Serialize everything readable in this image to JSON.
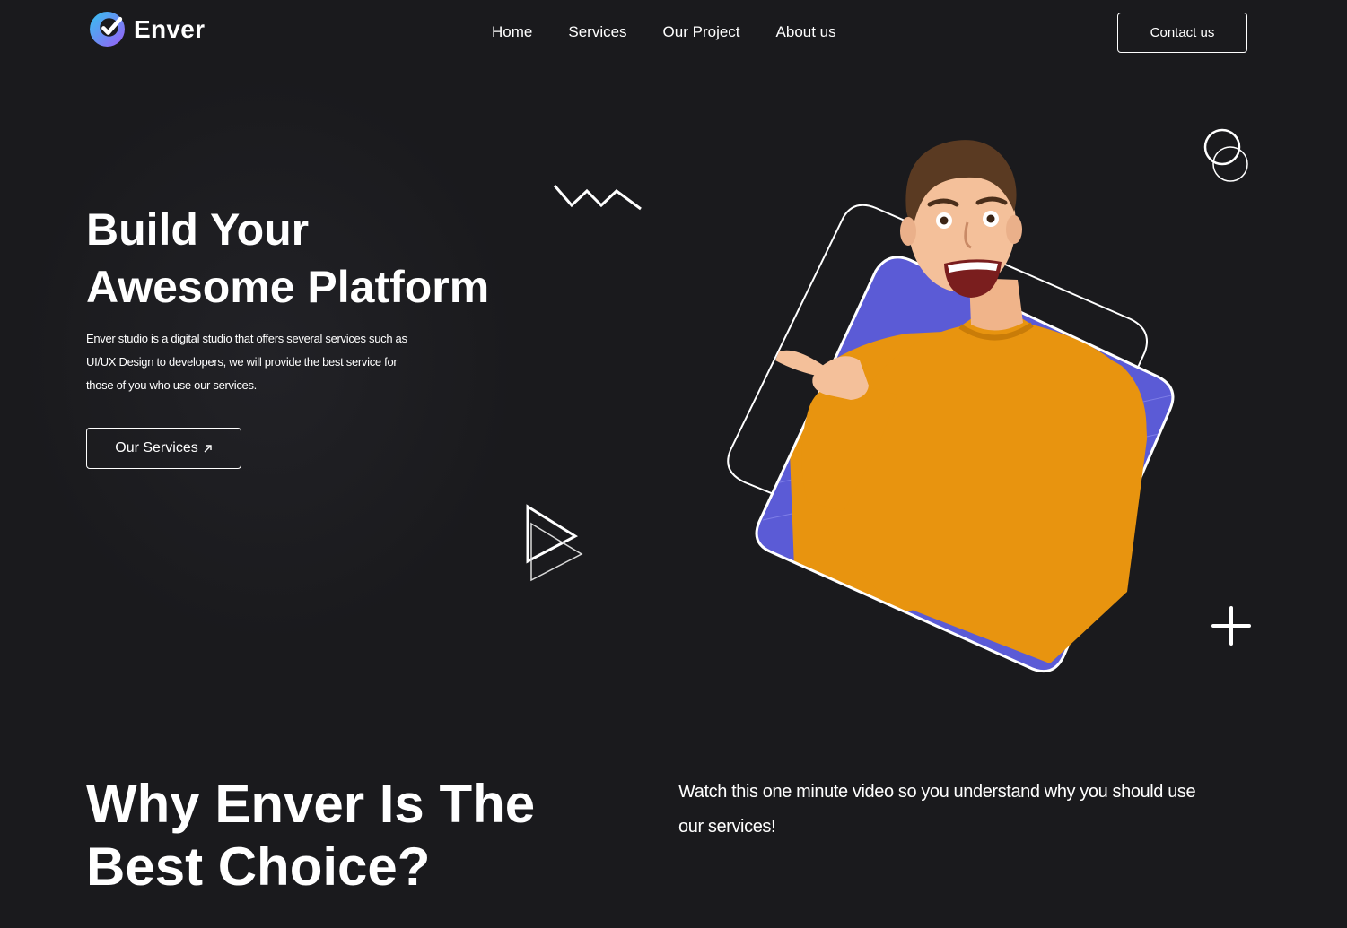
{
  "brand": {
    "name": "Enver",
    "logo_gradient": [
      "#33c3f0",
      "#8b5cf6"
    ]
  },
  "nav": {
    "items": [
      {
        "label": "Home"
      },
      {
        "label": "Services"
      },
      {
        "label": "Our Project"
      },
      {
        "label": "About us"
      }
    ],
    "contact_label": "Contact us"
  },
  "hero": {
    "title_line1": "Build Your",
    "title_line2": "Awesome Platform",
    "description": "Enver studio is a digital studio that offers several services such as UI/UX Design to developers, we will provide the best service for those of you who use our services.",
    "cta_label": "Our Services",
    "cta_icon": "arrow-up-right-icon"
  },
  "decorations": {
    "icons": [
      "zigzag-icon",
      "play-triangles-icon",
      "double-circle-icon",
      "plus-icon"
    ]
  },
  "hero_image": {
    "subject": "man-in-orange-sweater-pointing",
    "card_color": "#5b5bd6",
    "sweater_color": "#e8940f"
  },
  "why": {
    "title_line1": "Why Enver Is The",
    "title_line2": "Best Choice?",
    "description": "Watch this one minute video so you understand why you should use our services!"
  },
  "colors": {
    "background": "#1a1a1d",
    "text": "#ffffff",
    "accent": "#5b5bd6"
  }
}
